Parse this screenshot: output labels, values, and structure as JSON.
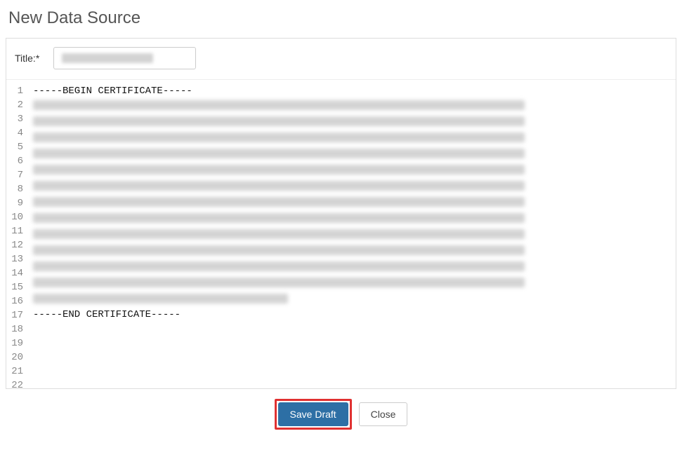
{
  "header": {
    "page_title": "New Data Source"
  },
  "form": {
    "title_label": "Title:*",
    "title_value": "",
    "title_placeholder_redacted": true
  },
  "editor": {
    "total_visible_lines": 22,
    "lines": [
      {
        "n": 1,
        "kind": "text",
        "text": "-----BEGIN CERTIFICATE-----"
      },
      {
        "n": 2,
        "kind": "redacted",
        "width": "long"
      },
      {
        "n": 3,
        "kind": "redacted",
        "width": "long"
      },
      {
        "n": 4,
        "kind": "redacted",
        "width": "long"
      },
      {
        "n": 5,
        "kind": "redacted",
        "width": "long"
      },
      {
        "n": 6,
        "kind": "redacted",
        "width": "long"
      },
      {
        "n": 7,
        "kind": "redacted",
        "width": "long"
      },
      {
        "n": 8,
        "kind": "redacted",
        "width": "long"
      },
      {
        "n": 9,
        "kind": "redacted",
        "width": "long"
      },
      {
        "n": 10,
        "kind": "redacted",
        "width": "long"
      },
      {
        "n": 11,
        "kind": "redacted",
        "width": "long"
      },
      {
        "n": 12,
        "kind": "redacted",
        "width": "long"
      },
      {
        "n": 13,
        "kind": "redacted",
        "width": "long"
      },
      {
        "n": 14,
        "kind": "redacted",
        "width": "short"
      },
      {
        "n": 15,
        "kind": "text",
        "text": "-----END CERTIFICATE-----"
      },
      {
        "n": 16,
        "kind": "empty"
      },
      {
        "n": 17,
        "kind": "empty"
      },
      {
        "n": 18,
        "kind": "empty"
      },
      {
        "n": 19,
        "kind": "empty"
      },
      {
        "n": 20,
        "kind": "empty"
      },
      {
        "n": 21,
        "kind": "empty"
      },
      {
        "n": 22,
        "kind": "empty"
      }
    ]
  },
  "actions": {
    "save_draft_label": "Save Draft",
    "close_label": "Close"
  },
  "colors": {
    "primary": "#2d6fa5",
    "highlight": "#e03131"
  }
}
